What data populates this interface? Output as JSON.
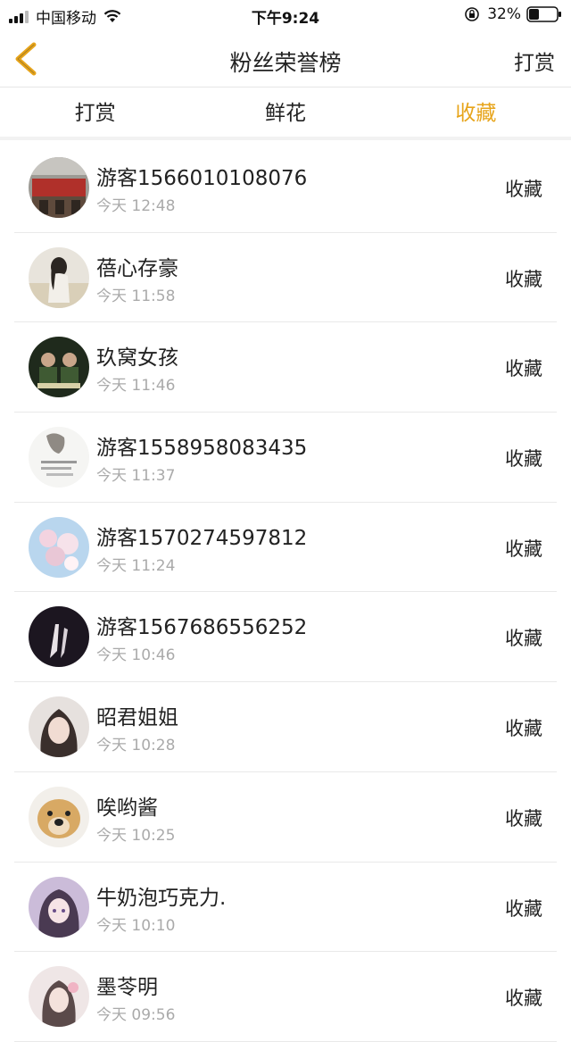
{
  "status_bar": {
    "carrier": "中国移动",
    "time": "下午9:24",
    "battery": "32%",
    "icons": [
      "signal-icon",
      "wifi-icon",
      "orientation-lock-icon",
      "battery-icon"
    ]
  },
  "nav": {
    "title": "粉丝荣誉榜",
    "right_label": "打赏",
    "back_icon": "chevron-left-icon",
    "accent": "#e7a41a"
  },
  "tabs": [
    {
      "label": "打赏",
      "active": false
    },
    {
      "label": "鲜花",
      "active": false
    },
    {
      "label": "收藏",
      "active": true
    }
  ],
  "items": [
    {
      "name": "游客1566010108076",
      "time": "今天 12:48",
      "action": "收藏",
      "avatar": "avatar-building"
    },
    {
      "name": "蓓心存豪",
      "time": "今天 11:58",
      "action": "收藏",
      "avatar": "avatar-girl-field"
    },
    {
      "name": "玖窝女孩",
      "time": "今天 11:46",
      "action": "收藏",
      "avatar": "avatar-two-people"
    },
    {
      "name": "游客1558958083435",
      "time": "今天 11:37",
      "action": "收藏",
      "avatar": "avatar-sketch"
    },
    {
      "name": "游客1570274597812",
      "time": "今天 11:24",
      "action": "收藏",
      "avatar": "avatar-flowers"
    },
    {
      "name": "游客1567686556252",
      "time": "今天 10:46",
      "action": "收藏",
      "avatar": "avatar-hands-dark"
    },
    {
      "name": "昭君姐姐",
      "time": "今天 10:28",
      "action": "收藏",
      "avatar": "avatar-girl-portrait"
    },
    {
      "name": "唉哟酱",
      "time": "今天 10:25",
      "action": "收藏",
      "avatar": "avatar-puppy"
    },
    {
      "name": "牛奶泡巧克力.",
      "time": "今天 10:10",
      "action": "收藏",
      "avatar": "avatar-anime-girl"
    },
    {
      "name": "墨苓明",
      "time": "今天 09:56",
      "action": "收藏",
      "avatar": "avatar-girl-pink"
    }
  ]
}
